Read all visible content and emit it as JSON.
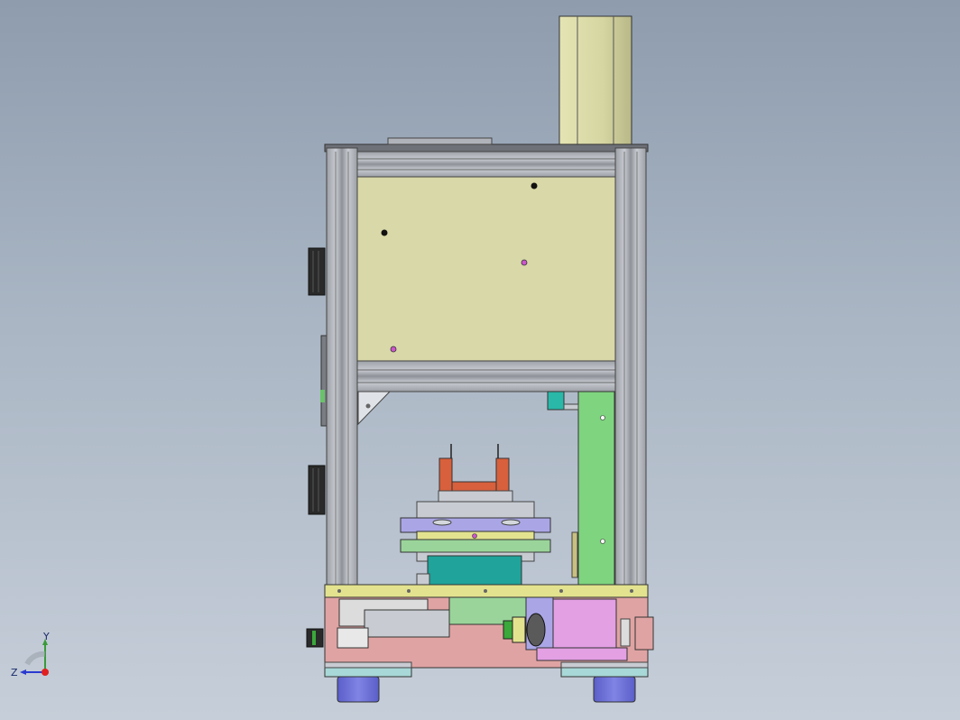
{
  "viewport": {
    "background_top": "#8e9cae",
    "background_bottom": "#c6ced9"
  },
  "model": {
    "colors": {
      "frame_profile": "#b4b8be",
      "frame_profile_dark": "#8e9298",
      "cover_panel": "#d8d8a8",
      "cylinder": "#d9d9a6",
      "green_plate": "#7fd47f",
      "base_plate": "#e0a3a3",
      "yellow_rail": "#e3e38f",
      "gripper": "#d8603c",
      "lavender_plate": "#aaa6e6",
      "teal_block": "#1fa39a",
      "magenta_block": "#e3a0e3",
      "feet": "#6f72d6",
      "cyan_rail": "#a8d8d8"
    }
  },
  "triad": {
    "axes": [
      {
        "name": "y-axis",
        "label": "Y",
        "color": "#3a9a3a"
      },
      {
        "name": "z-axis",
        "label": "Z",
        "color": "#2a3ad0"
      },
      {
        "name": "x-axis",
        "label": "",
        "color": "#e02020"
      }
    ]
  }
}
